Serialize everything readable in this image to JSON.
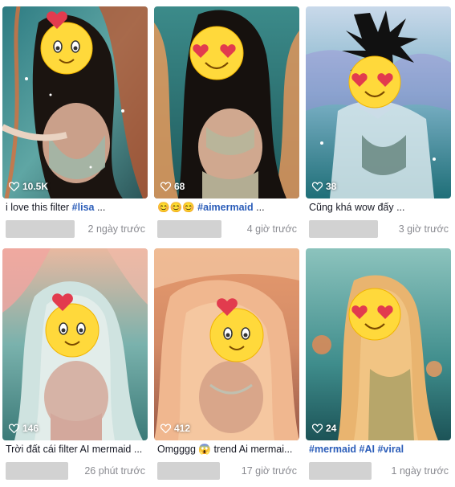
{
  "videos": [
    {
      "likes": "10.5K",
      "caption_text": "i love this filter ",
      "caption_tag": "#lisa",
      "caption_tail": " ...",
      "time": "2 ngày trước",
      "emoji_icon": "heart-eyes-emoji-icon"
    },
    {
      "likes": "68",
      "caption_text": "😊😊😊 ",
      "caption_tag": "#aimermaid",
      "caption_tail": " ...",
      "time": "4 giờ trước",
      "emoji_icon": "heart-eyes-emoji-icon"
    },
    {
      "likes": "38",
      "caption_text": "Cũng khá wow đấy ...",
      "caption_tag": "",
      "caption_tail": "",
      "time": "3 giờ trước",
      "emoji_icon": "heart-eyes-emoji-icon"
    },
    {
      "likes": "146",
      "caption_text": "Trời đất cái filter AI mermaid ...",
      "caption_tag": "",
      "caption_tail": "",
      "time": "26 phút trước",
      "emoji_icon": "heart-eyes-emoji-icon"
    },
    {
      "likes": "412",
      "caption_text": "Omgggg 😱 trend Ai mermai...",
      "caption_tag": "",
      "caption_tail": "",
      "time": "17 giờ trước",
      "emoji_icon": "heart-eyes-emoji-icon"
    },
    {
      "likes": "24",
      "caption_text": "",
      "caption_tag": "#mermaid #AI #viral",
      "caption_tail": "",
      "time": "1 ngày trước",
      "emoji_icon": "heart-eyes-emoji-icon"
    }
  ],
  "colors": {
    "hashtag": "#2b5db9",
    "caption": "#161823",
    "time": "#8a8b91",
    "blur_placeholder": "#d2d2d2"
  }
}
